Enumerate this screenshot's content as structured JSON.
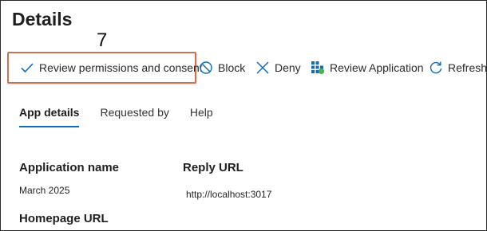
{
  "header": {
    "title": "Details"
  },
  "annotation": {
    "step_number": "7"
  },
  "toolbar": {
    "review_permissions": {
      "label": "Review permissions and consent",
      "icon": "checkmark-icon"
    },
    "block": {
      "label": "Block",
      "icon": "block-icon"
    },
    "deny": {
      "label": "Deny",
      "icon": "close-icon"
    },
    "review_application": {
      "label": "Review Application",
      "icon": "app-grid-icon"
    },
    "refresh": {
      "label": "Refresh",
      "icon": "refresh-icon"
    }
  },
  "tabs": [
    {
      "label": "App details",
      "active": true
    },
    {
      "label": "Requested by",
      "active": false
    },
    {
      "label": "Help",
      "active": false
    }
  ],
  "details": {
    "application_name_label": "Application name",
    "application_name_value": "March 2025",
    "reply_url_label": "Reply URL",
    "reply_url_value": "http://localhost:3017",
    "homepage_url_label": "Homepage URL"
  },
  "colors": {
    "accent": "#0f6cbd",
    "highlight_border": "#c97352",
    "app_icon_green": "#4caf50"
  }
}
